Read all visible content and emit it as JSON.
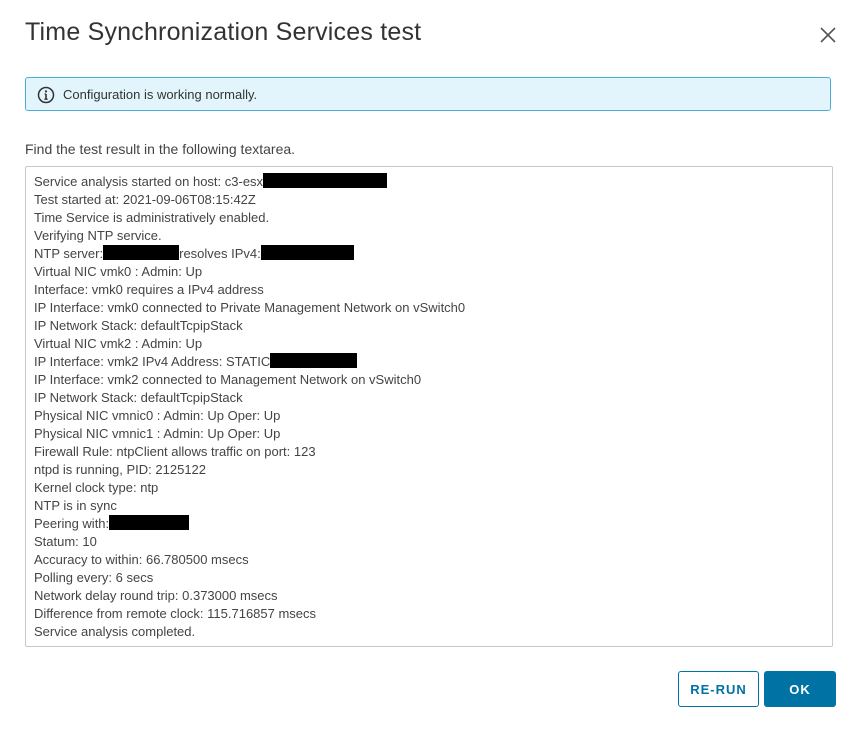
{
  "dialog": {
    "title": "Time Synchronization Services test",
    "close_icon": "close-icon"
  },
  "alert": {
    "icon": "info-circle-icon",
    "text": "Configuration is working normally.",
    "color": "#49afd9"
  },
  "instruction": "Find the test result in the following textarea.",
  "log": {
    "lines": [
      {
        "text": "Service analysis started on host: c3-esx",
        "redact_after": true
      },
      {
        "text": "Test started at: 2021-09-06T08:15:42Z"
      },
      {
        "text": "Time Service is administratively enabled."
      },
      {
        "text": "Verifying NTP service."
      },
      {
        "text": "NTP server:",
        "mid": "resolves IPv4:",
        "redact_mid": true,
        "redact_after": true
      },
      {
        "text": "Virtual NIC vmk0 : Admin: Up"
      },
      {
        "text": "Interface: vmk0 requires a IPv4 address"
      },
      {
        "text": "IP Interface: vmk0 connected to Private Management Network on vSwitch0"
      },
      {
        "text": "IP Network Stack: defaultTcpipStack"
      },
      {
        "text": "Virtual NIC vmk2 : Admin: Up"
      },
      {
        "text": "IP Interface: vmk2 IPv4 Address: STATIC",
        "redact_after": true
      },
      {
        "text": "IP Interface: vmk2 connected to Management Network on vSwitch0"
      },
      {
        "text": "IP Network Stack: defaultTcpipStack"
      },
      {
        "text": "Physical NIC vmnic0 : Admin: Up Oper: Up"
      },
      {
        "text": "Physical NIC vmnic1 : Admin: Up Oper: Up"
      },
      {
        "text": "Firewall Rule: ntpClient allows traffic on port: 123"
      },
      {
        "text": "ntpd is running, PID: 2125122"
      },
      {
        "text": "Kernel clock type: ntp"
      },
      {
        "text": "NTP is in sync"
      },
      {
        "text": "Peering with:",
        "redact_after": true
      },
      {
        "text": "Statum: 10"
      },
      {
        "text": "Accuracy to within: 66.780500 msecs"
      },
      {
        "text": "Polling every: 6 secs"
      },
      {
        "text": "Network delay round trip: 0.373000 msecs"
      },
      {
        "text": "Difference from remote clock: 115.716857 msecs"
      },
      {
        "text": "Service analysis completed."
      }
    ]
  },
  "buttons": {
    "rerun_label": "RE-RUN",
    "ok_label": "OK"
  },
  "colors": {
    "primary": "#0072a3",
    "alert_bg": "#e3f5fc",
    "alert_border": "#49afd9"
  }
}
